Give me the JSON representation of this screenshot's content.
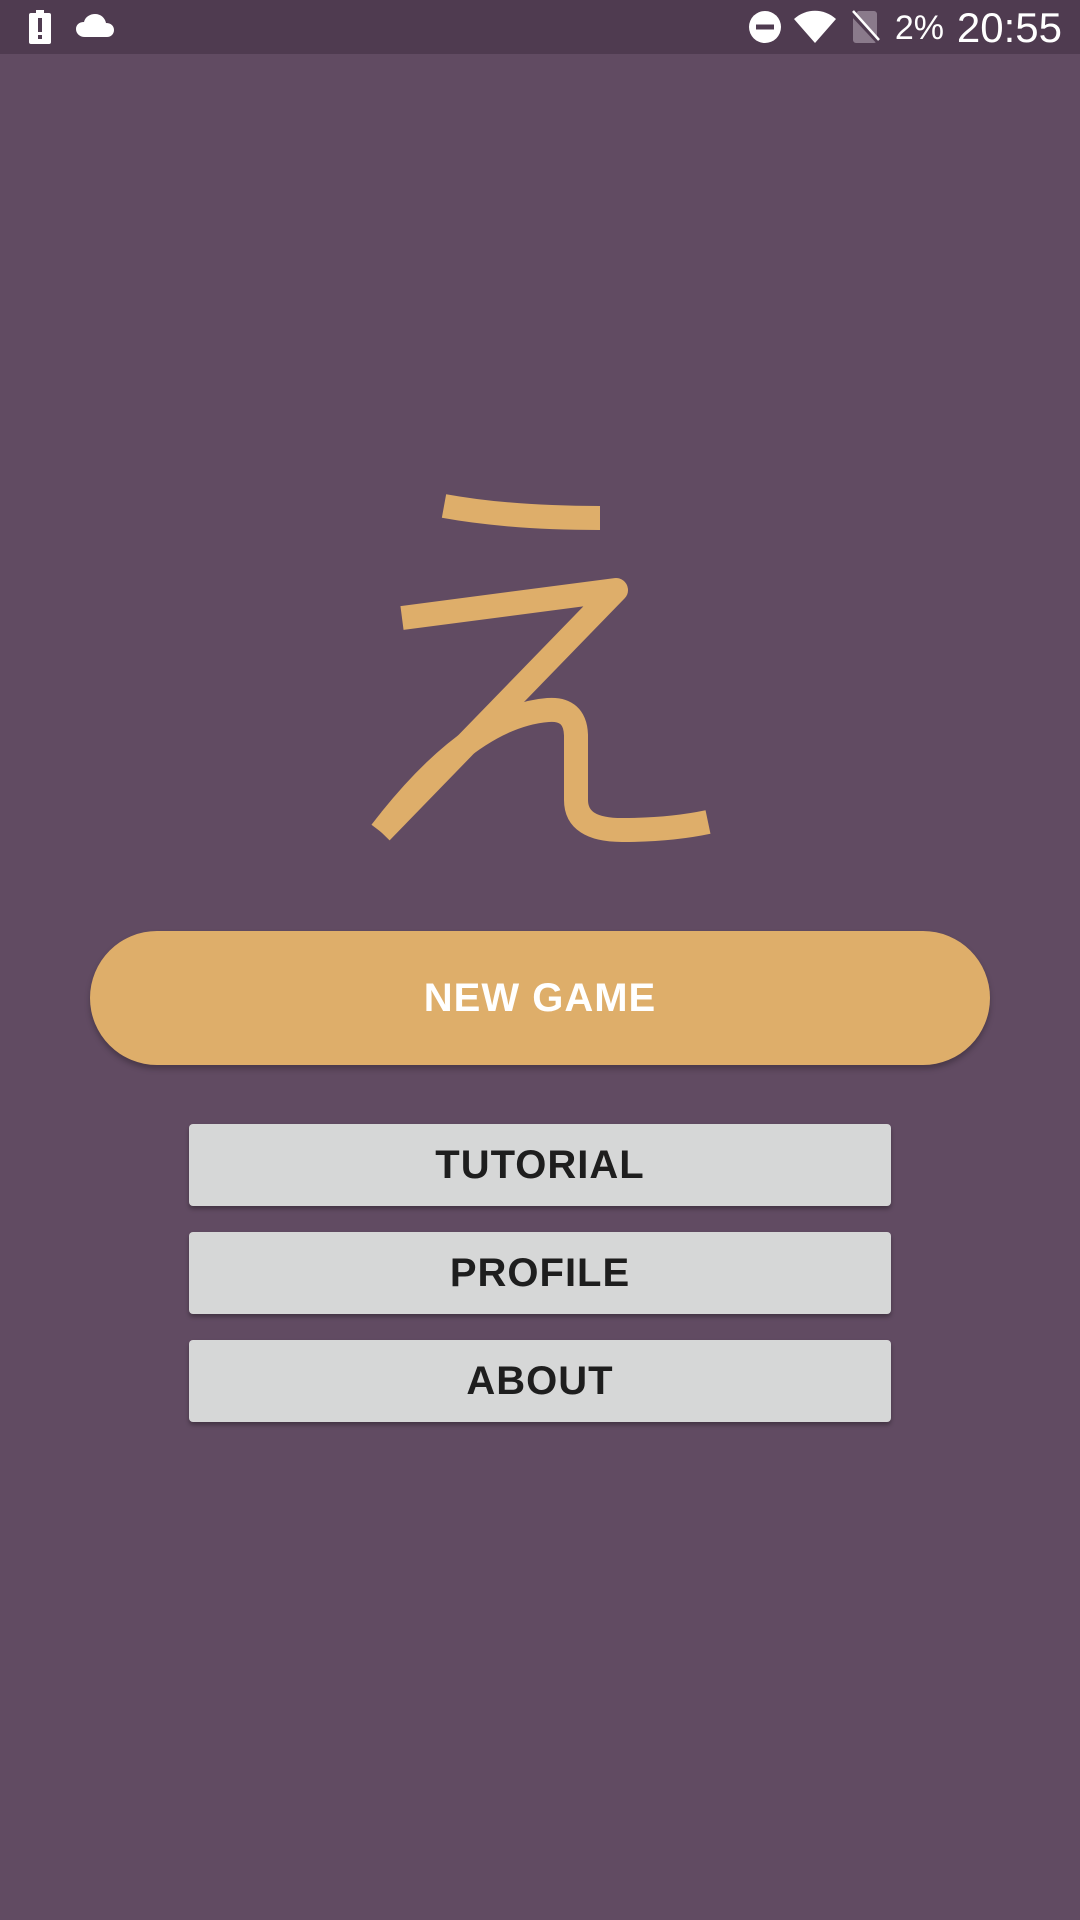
{
  "status_bar": {
    "battery_percent": "2%",
    "time": "20:55",
    "icons": {
      "left": [
        "battery-alert-icon",
        "cloud-icon"
      ],
      "right": [
        "do-not-disturb-icon",
        "wifi-icon",
        "no-sim-icon"
      ]
    }
  },
  "logo": {
    "icon": "hiragana-e-logo-icon",
    "color": "#deae6a"
  },
  "menu": {
    "new_game_label": "NEW GAME",
    "tutorial_label": "TUTORIAL",
    "profile_label": "PROFILE",
    "about_label": "ABOUT"
  },
  "colors": {
    "background": "#614b62",
    "status_bar": "#4f3b50",
    "accent": "#deae6a",
    "secondary_button": "#d6d7d7",
    "secondary_text": "#1e1e1e"
  }
}
